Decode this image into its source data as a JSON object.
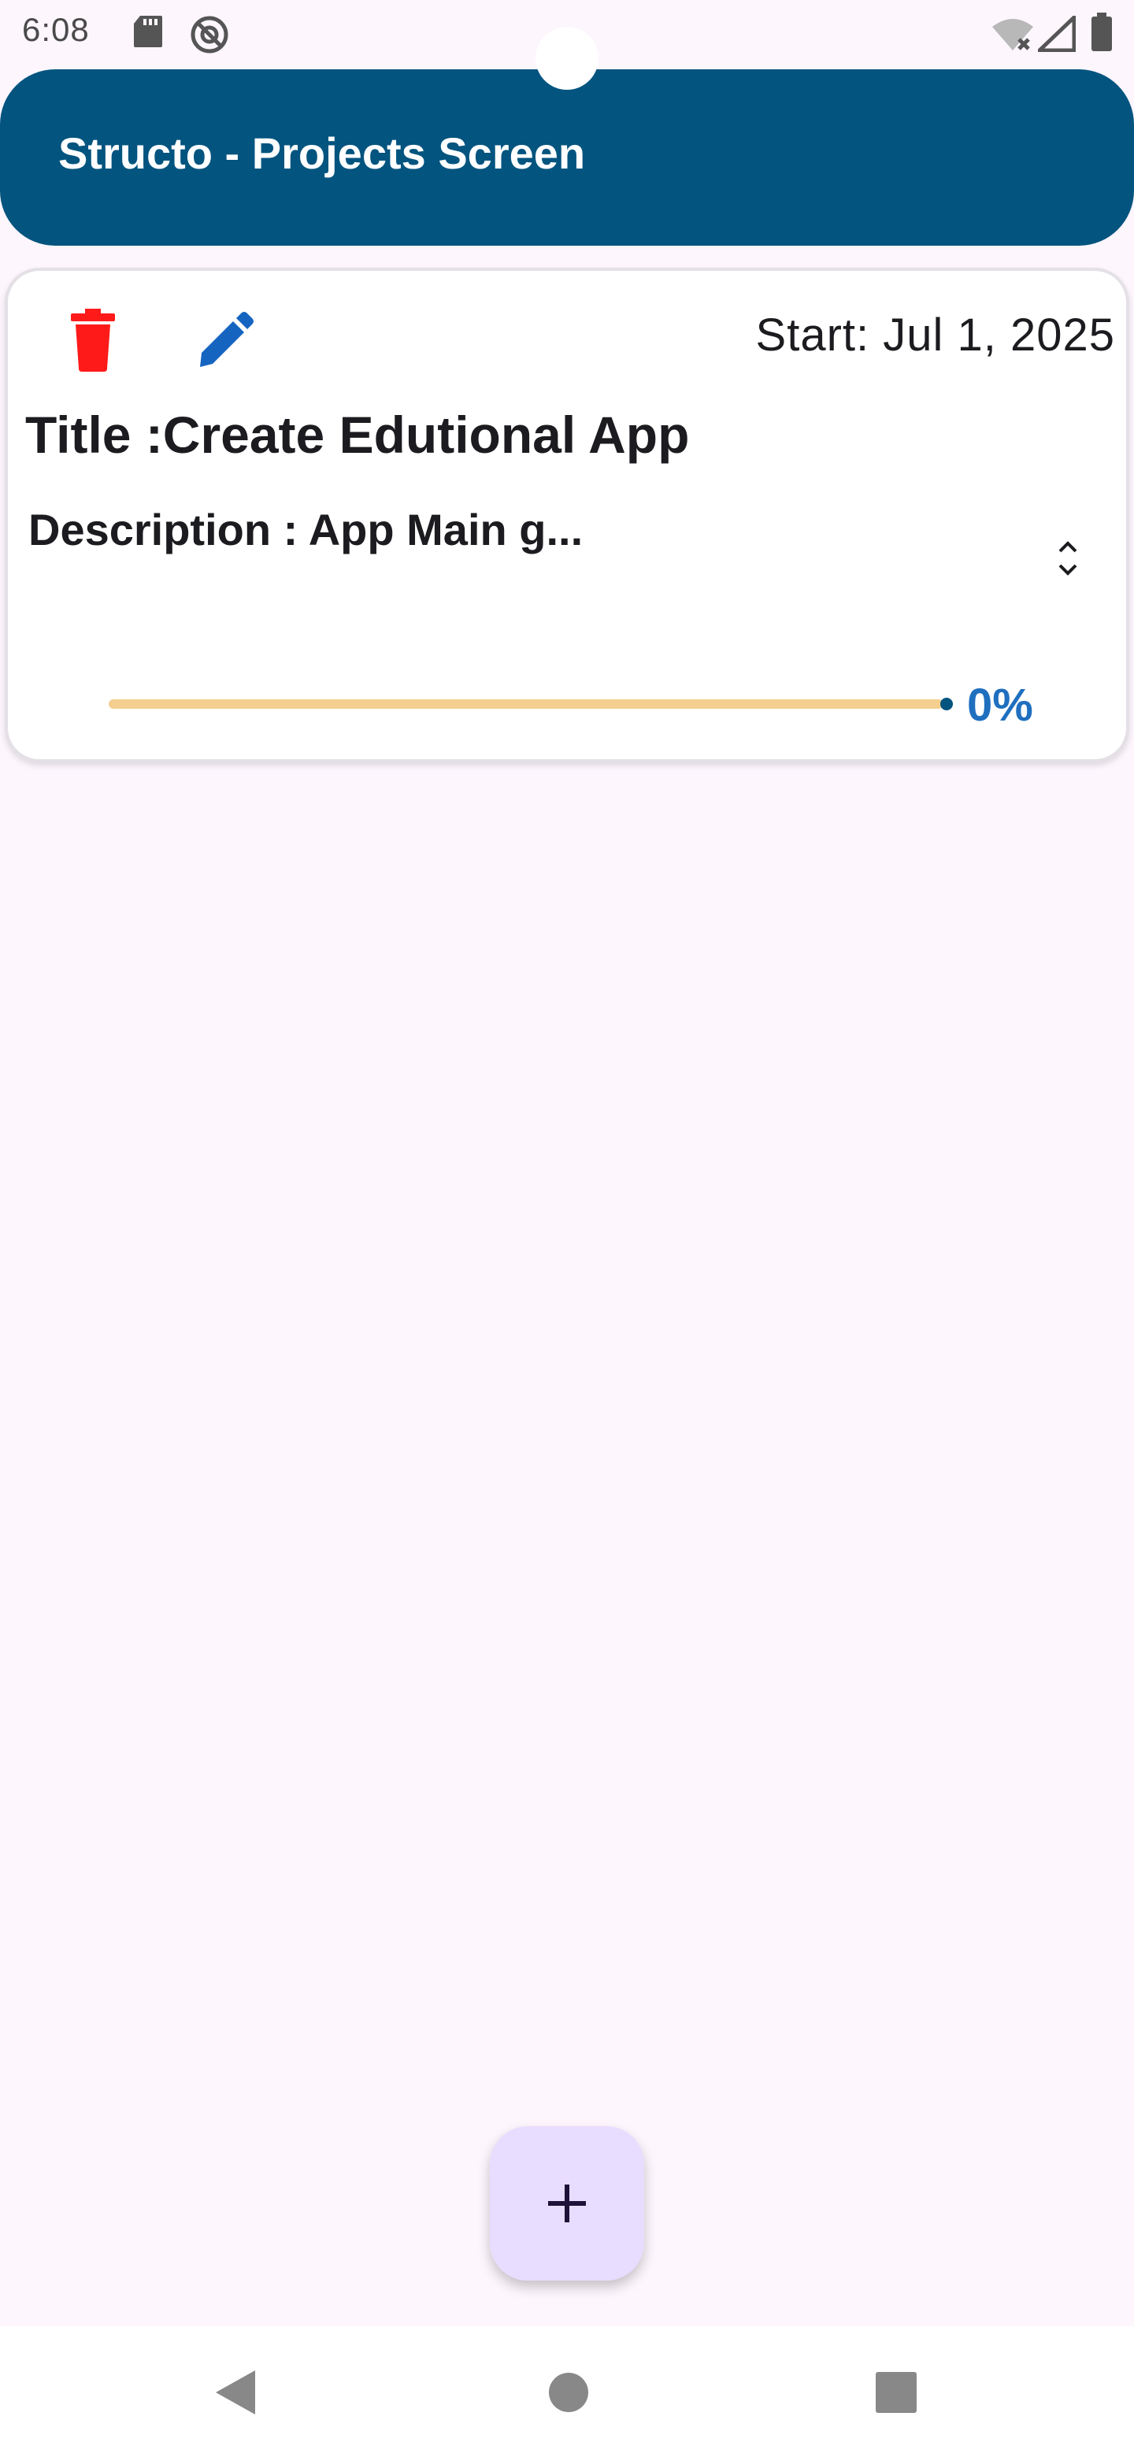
{
  "status_bar": {
    "time": "6:08",
    "icons": [
      "sd-card-icon",
      "at-sign-icon",
      "wifi-off-icon",
      "signal-icon",
      "battery-icon"
    ]
  },
  "app_bar": {
    "title": "Structo - Projects Screen",
    "color": "#03547f"
  },
  "project_card": {
    "start_date": "Start: Jul 1, 2025",
    "title": "Title :Create Edutional App",
    "description": "Description : App Main g...",
    "progress_value": 0,
    "progress_label": "0%",
    "delete_color": "#ff1a1a",
    "edit_color": "#1565c0"
  },
  "fab": {
    "icon": "plus-icon",
    "color": "#e9ddff"
  },
  "nav_bar": {
    "buttons": [
      "back-icon",
      "home-icon",
      "recents-icon"
    ]
  }
}
